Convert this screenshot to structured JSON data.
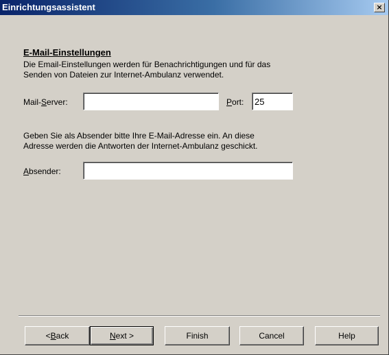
{
  "window": {
    "title": "Einrichtungsassistent",
    "close_glyph": "×",
    "close_icon": "close-icon"
  },
  "section": {
    "heading": "E-Mail-Einstellungen",
    "intro_line1": "Die Email-Einstellungen werden für Benachrichtigungen und für das",
    "intro_line2": "Senden von Dateien zur Internet-Ambulanz verwendet."
  },
  "mail_server": {
    "label_pre": "Mail-",
    "label_underlined": "S",
    "label_post": "erver:",
    "value": ""
  },
  "port": {
    "label_underlined": "P",
    "label_post": "ort:",
    "value": "25"
  },
  "sender_info": {
    "line1": "Geben Sie als Absender bitte Ihre E-Mail-Adresse ein. An diese",
    "line2": "Adresse werden die Antworten der Internet-Ambulanz geschickt."
  },
  "sender": {
    "label_underlined": "A",
    "label_post": "bsender:",
    "value": ""
  },
  "buttons": {
    "back_pre": "< ",
    "back_underlined": "B",
    "back_post": "ack",
    "next_underlined": "N",
    "next_post": "ext >",
    "finish": "Finish",
    "cancel": "Cancel",
    "help": "Help"
  }
}
